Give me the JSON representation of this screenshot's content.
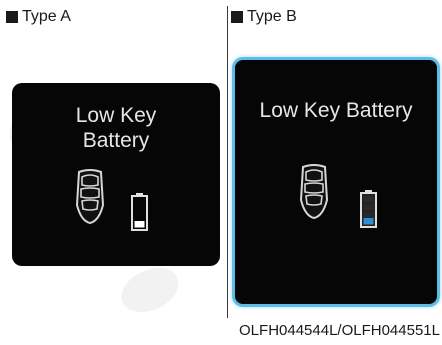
{
  "type_a": {
    "label": "Type A",
    "message_line1": "Low Key",
    "message_line2": "Battery",
    "battery_level": 1
  },
  "type_b": {
    "label": "Type B",
    "message": "Low Key Battery",
    "battery_level": 1
  },
  "caption": "OLFH044544L/OLFH044551L",
  "colors": {
    "panel_background": "#060606",
    "type_b_border": "#5dbde8",
    "type_a_battery_fill": "#ffffff",
    "type_b_battery_fill": "#2d8fd3"
  },
  "icons": [
    "key-fob-icon",
    "battery-icon"
  ]
}
